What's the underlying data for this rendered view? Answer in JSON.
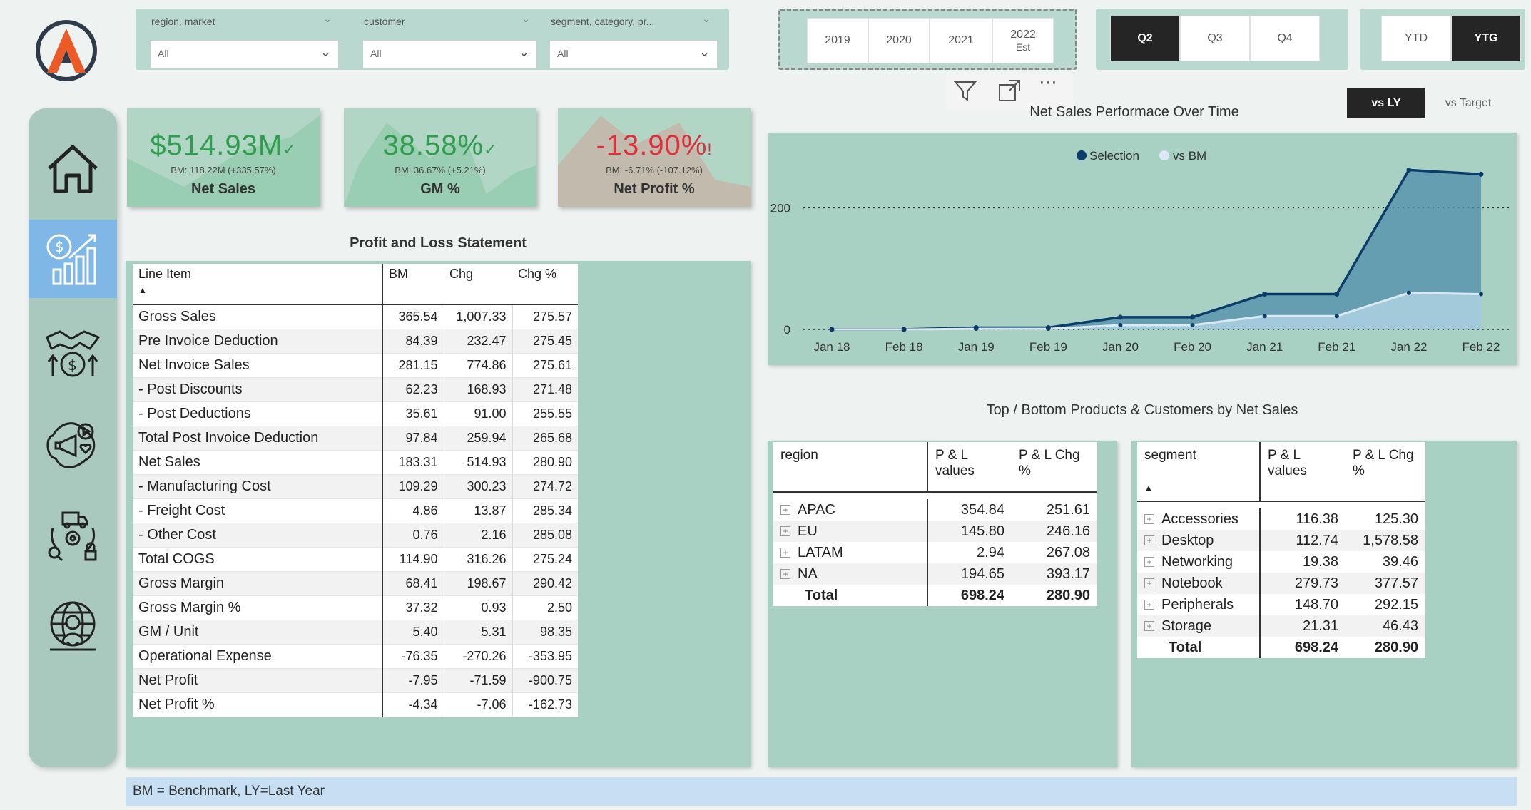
{
  "filters": [
    {
      "title": "region, market",
      "value": "All"
    },
    {
      "title": "customer",
      "value": "All"
    },
    {
      "title": "segment, category, pr...",
      "value": "All"
    }
  ],
  "years": [
    {
      "label": "2019",
      "sub": ""
    },
    {
      "label": "2020",
      "sub": ""
    },
    {
      "label": "2021",
      "sub": ""
    },
    {
      "label": "2022",
      "sub": "Est"
    }
  ],
  "quarters": [
    {
      "label": "Q2",
      "selected": true
    },
    {
      "label": "Q3",
      "selected": false
    },
    {
      "label": "Q4",
      "selected": false
    }
  ],
  "period_modes": [
    {
      "label": "YTD",
      "selected": false
    },
    {
      "label": "YTG",
      "selected": true
    }
  ],
  "compare": {
    "vs_ly": "vs LY",
    "vs_target": "vs Target"
  },
  "kpis": [
    {
      "value": "$514.93M",
      "mark": "✓",
      "bm": "BM: 118.22M (+335.57%)",
      "label": "Net Sales",
      "color": "#2e9e4c"
    },
    {
      "value": "38.58%",
      "mark": "✓",
      "bm": "BM: 36.67% (+5.21%)",
      "label": "GM %",
      "color": "#2e9e4c"
    },
    {
      "value": "-13.90%",
      "mark": "!",
      "bm": "BM: -6.71% (-107.12%)",
      "label": "Net Profit %",
      "color": "#e0303a"
    }
  ],
  "pnl": {
    "title": "Profit and Loss Statement",
    "headers": [
      "Line Item",
      "BM",
      "Chg",
      "Chg %"
    ],
    "rows": [
      [
        "Gross Sales",
        "365.54",
        "1,007.33",
        "275.57"
      ],
      [
        "Pre Invoice Deduction",
        "84.39",
        "232.47",
        "275.45"
      ],
      [
        "Net Invoice Sales",
        "281.15",
        "774.86",
        "275.61"
      ],
      [
        "- Post Discounts",
        "62.23",
        "168.93",
        "271.48"
      ],
      [
        "- Post Deductions",
        "35.61",
        "91.00",
        "255.55"
      ],
      [
        "Total Post Invoice Deduction",
        "97.84",
        "259.94",
        "265.68"
      ],
      [
        "Net Sales",
        "183.31",
        "514.93",
        "280.90"
      ],
      [
        "- Manufacturing Cost",
        "109.29",
        "300.23",
        "274.72"
      ],
      [
        "- Freight Cost",
        "4.86",
        "13.87",
        "285.34"
      ],
      [
        "- Other Cost",
        "0.76",
        "2.16",
        "285.08"
      ],
      [
        "Total COGS",
        "114.90",
        "316.26",
        "275.24"
      ],
      [
        "Gross Margin",
        "68.41",
        "198.67",
        "290.42"
      ],
      [
        "Gross Margin %",
        "37.32",
        "0.93",
        "2.50"
      ],
      [
        "GM / Unit",
        "5.40",
        "5.31",
        "98.35"
      ],
      [
        "Operational Expense",
        "-76.35",
        "-270.26",
        "-353.95"
      ],
      [
        "Net Profit",
        "-7.95",
        "-71.59",
        "-900.75"
      ],
      [
        "Net Profit %",
        "-4.34",
        "-7.06",
        "-162.73"
      ]
    ]
  },
  "chart_data": {
    "type": "area",
    "title": "Net Sales Performace Over Time",
    "legend_position": "top-center",
    "x": [
      "Jan 18",
      "Feb 18",
      "Jan 19",
      "Feb 19",
      "Jan 20",
      "Feb 20",
      "Jan 21",
      "Feb 21",
      "Jan 22",
      "Feb 22"
    ],
    "series": [
      {
        "name": "Selection",
        "values": [
          0,
          0,
          3,
          3,
          20,
          20,
          58,
          58,
          262,
          255
        ],
        "color": "#0b3d6b"
      },
      {
        "name": "vs BM",
        "values": [
          0,
          0,
          1,
          1,
          7,
          7,
          22,
          22,
          60,
          58
        ],
        "color": "#dce9f5"
      }
    ],
    "y_ticks": [
      0,
      200
    ],
    "ylim": [
      0,
      300
    ],
    "grid": "dotted at ticks"
  },
  "bottom": {
    "title": "Top / Bottom Products & Customers by Net Sales",
    "region_table": {
      "headers": [
        "region",
        "P & L values",
        "P & L Chg %"
      ],
      "rows": [
        [
          "APAC",
          "354.84",
          "251.61"
        ],
        [
          "EU",
          "145.80",
          "246.16"
        ],
        [
          "LATAM",
          "2.94",
          "267.08"
        ],
        [
          "NA",
          "194.65",
          "393.17"
        ]
      ],
      "total": [
        "Total",
        "698.24",
        "280.90"
      ]
    },
    "segment_table": {
      "headers": [
        "segment",
        "P & L values",
        "P & L Chg %"
      ],
      "rows": [
        [
          "Accessories",
          "116.38",
          "125.30"
        ],
        [
          "Desktop",
          "112.74",
          "1,578.58"
        ],
        [
          "Networking",
          "19.38",
          "39.46"
        ],
        [
          "Notebook",
          "279.73",
          "377.57"
        ],
        [
          "Peripherals",
          "148.70",
          "292.15"
        ],
        [
          "Storage",
          "21.31",
          "46.43"
        ]
      ],
      "total": [
        "Total",
        "698.24",
        "280.90"
      ]
    }
  },
  "footer": "BM = Benchmark, LY=Last Year",
  "nav_icons": [
    "home-icon",
    "finance-chart-icon",
    "handshake-money-icon",
    "marketing-icon",
    "supply-chain-icon",
    "global-people-icon"
  ]
}
